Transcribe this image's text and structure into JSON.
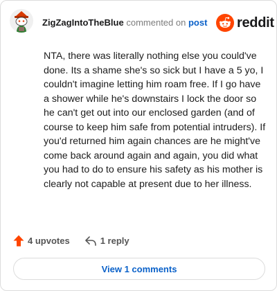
{
  "header": {
    "username": "ZigZagIntoTheBlue",
    "action": "commented on",
    "post_link": "post"
  },
  "brand": {
    "name": "reddit",
    "color": "#ff4500"
  },
  "comment": {
    "text": "NTA, there was literally nothing else you could've done. Its a shame she's so sick but I have a 5 yo, I couldn't imagine letting him roam free. If I go have a shower while he's downstairs I lock the door so he can't get out into our enclosed garden (and of course to keep him safe from potential intruders). If you'd returned him again chances are he might've come back around again and again, you did what you had to do to ensure his safety as his mother is clearly not capable at present due to her illness."
  },
  "footer": {
    "upvotes": "4 upvotes",
    "replies": "1 reply"
  },
  "view_comments": "View 1 comments",
  "colors": {
    "upvote": "#ff4500",
    "link": "#0a61c9"
  },
  "icons": [
    "avatar",
    "reddit-logo-icon",
    "upvote-arrow-icon",
    "reply-arrow-icon"
  ]
}
